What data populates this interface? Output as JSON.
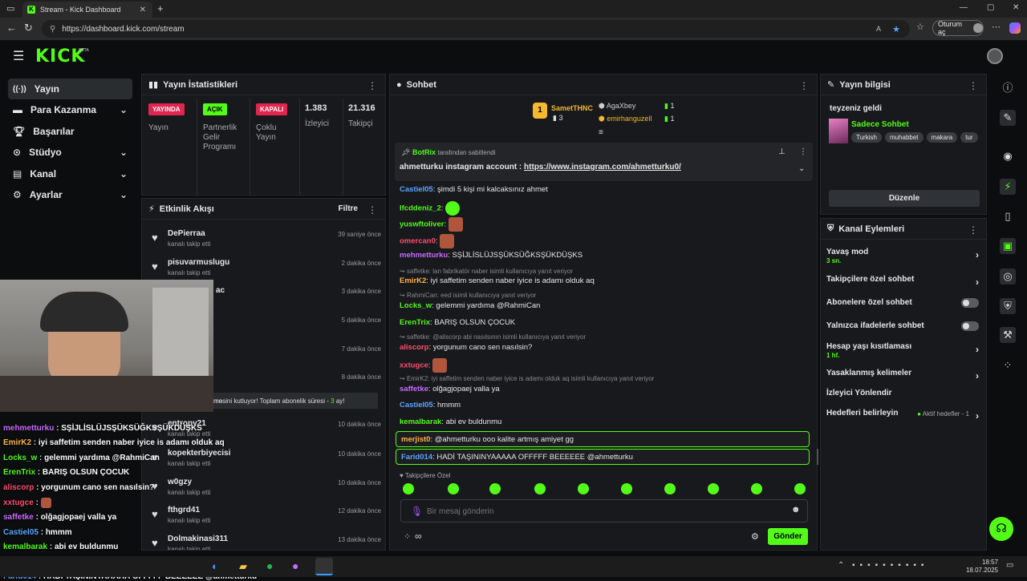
{
  "browser": {
    "tab_title": "Stream - Kick Dashboard",
    "url": "https://dashboard.kick.com/stream",
    "profile_label": "Oturum aç"
  },
  "brand": {
    "logo": "KICK",
    "beta": "BETA",
    "accent": "#53fc18"
  },
  "sidebar": {
    "items": [
      {
        "label": "Yayın",
        "icon": "broadcast-icon"
      },
      {
        "label": "Para Kazanma",
        "icon": "money-icon"
      },
      {
        "label": "Başarılar",
        "icon": "trophy-icon"
      },
      {
        "label": "Stüdyo",
        "icon": "studio-icon"
      },
      {
        "label": "Kanal",
        "icon": "channel-icon"
      },
      {
        "label": "Ayarlar",
        "icon": "gear-icon"
      }
    ]
  },
  "stats": {
    "title": "Yayın İstatistikleri",
    "boxes": [
      {
        "tag": "YAYINDA",
        "label": "Yayın"
      },
      {
        "tag": "AÇIK",
        "label": "Partnerlik Gelir Programı"
      },
      {
        "tag": "KAPALI",
        "label": "Çoklu Yayın"
      },
      {
        "value": "1.383",
        "label": "İzleyici"
      },
      {
        "value": "21.316",
        "label": "Takipçi"
      }
    ]
  },
  "activity": {
    "title": "Etkinlik Akışı",
    "filter": "Filtre",
    "events": [
      {
        "name": "DePierraa",
        "sub": "kanalı takip etti",
        "time": "39 saniye önce"
      },
      {
        "name": "pisuvarmuslugu",
        "sub": "kanalı takip etti",
        "time": "2 dakika önce"
      },
      {
        "name": "",
        "sub": "",
        "time": "3 dakika önce",
        "partial": "ac"
      },
      {
        "name": "",
        "sub": "",
        "time": "5 dakika önce"
      },
      {
        "name": "",
        "sub": "",
        "time": "7 dakika önce"
      },
      {
        "name": "",
        "sub": "",
        "time": "8 dakika önce"
      },
      {
        "name": "entropy21",
        "sub": "kanalı takip etti",
        "time": "10 dakika önce"
      },
      {
        "name": "kopekterbiyecisi",
        "sub": "kanalı takip etti",
        "time": "10 dakika önce"
      },
      {
        "name": "w0gzy",
        "sub": "kanalı takip etti",
        "time": "10 dakika önce"
      },
      {
        "name": "fthgrd41",
        "sub": "kanalı takip etti",
        "time": "12 dakika önce"
      },
      {
        "name": "Dolmakinasi311",
        "sub": "kanalı takip etti",
        "time": "13 dakika önce"
      }
    ],
    "sub_notice": "mesini kutluyor! Toplam abonelik süresi -",
    "sub_months": "3",
    "sub_months_suffix": "ay!",
    "sub_notice2": "mo"
  },
  "chat": {
    "title": "Sohbet",
    "leaders": [
      {
        "name": "SametTHNC",
        "count": "3"
      },
      {
        "name": "AgaXbey",
        "count": "1"
      },
      {
        "name": "emirhanguzell",
        "count": "1"
      }
    ],
    "pinned_by": "BotRix",
    "pinned_suffix": "tarafından sabitlendi",
    "pinned_text": "ahmetturku instagram account :",
    "pinned_link": "https://www.instagram.com/ahmetturku0/",
    "messages": [
      {
        "user": "Castiel05",
        "color": "#5aa6ff",
        "text": "şimdi 5 kişi mi kalcaksınız ahmet"
      },
      {
        "user": "lfcddeniz_2",
        "color": "#53fc18",
        "text": ""
      },
      {
        "user": "yuswftoliver",
        "color": "#53fc18",
        "text": ""
      },
      {
        "user": "omercan0",
        "color": "#ff4d6d",
        "text": ""
      },
      {
        "user": "mehmetturku",
        "color": "#c86bff",
        "text": "SŞİJLİSLÜJSŞÜKSÜĞKSŞÜKDÜŞKS"
      },
      {
        "reply": "saffetke: lan fabrikatör naber isimli kullanıcıya yanıt veriyor"
      },
      {
        "user": "EmirK2",
        "color": "#ffb347",
        "text": "iyi saffetim senden naber iyice is adamı olduk aq"
      },
      {
        "reply": "RahmiCan: eed isimli kullanıcıya yanıt veriyor"
      },
      {
        "user": "Locks_w",
        "color": "#53fc18",
        "text": "gelemmi yardıma @RahmiCan"
      },
      {
        "user": "ErenTrix",
        "color": "#53fc18",
        "text": "BARIŞ OLSUN ÇOCUK"
      },
      {
        "reply": "saffetke: @aliscorp abi nasılsının isimli kullanıcıya yanıt veriyor"
      },
      {
        "user": "aliscorp",
        "color": "#ff4d6d",
        "text": "yorgunum cano sen nasılsin?"
      },
      {
        "user": "xxtugce",
        "color": "#ff4d6d",
        "text": ""
      },
      {
        "reply": "EmirK2: iyi saffetim senden naber iyice is adamı olduk aq isimli kullanıcıya yanıt veriyor"
      },
      {
        "user": "saffetke",
        "color": "#c86bff",
        "text": "olğagjopaej valla ya"
      },
      {
        "user": "Castiel05",
        "color": "#5aa6ff",
        "text": "hmmm"
      },
      {
        "user": "kemalbarak",
        "color": "#53fc18",
        "text": "abi ev buldunmu"
      }
    ],
    "highlighted": [
      {
        "user": "merjist0",
        "color": "#ffb347",
        "text": "@ahmetturku ooo kalite artmış amiyet gg"
      },
      {
        "user": "Farid014",
        "color": "#5aa6ff",
        "text": "HADİ TAŞININYAAAAA OFFFFF BEEEEEE @ahmetturku"
      }
    ],
    "followers_only": "Takipçilere Özel",
    "input_placeholder": "Bir mesaj gönderin",
    "send": "Gönder"
  },
  "stream_info": {
    "title": "Yayın bilgisi",
    "stream_title": "teyzeniz geldi",
    "category": "Sadece Sohbet",
    "tags": [
      "Turkish",
      "muhabbet",
      "makara",
      "tur"
    ],
    "edit": "Düzenle"
  },
  "channel_actions": {
    "title": "Kanal Eylemleri",
    "rows": [
      {
        "label": "Yavaş mod",
        "sub": "3 sn.",
        "type": "chevron"
      },
      {
        "label": "Takipçilere özel sohbet",
        "type": "chevron"
      },
      {
        "label": "Abonelere özel sohbet",
        "type": "toggle"
      },
      {
        "label": "Yalnızca ifadelerle sohbet",
        "type": "toggle"
      },
      {
        "label": "Hesap yaşı kısıtlaması",
        "sub": "1 hf.",
        "type": "chevron"
      },
      {
        "label": "Yasaklanmış kelimeler",
        "type": "chevron"
      },
      {
        "label": "İzleyici Yönlendir",
        "type": "none"
      },
      {
        "label": "Hedefleri belirleyin",
        "badge": "Aktif hedefler - 1",
        "type": "chevron"
      }
    ]
  },
  "overlay_chat": [
    {
      "user": "mehmetturku",
      "color": "#c86bff",
      "text": "SŞİJLİSLÜJSŞÜKSÜĞKSŞÜKDÜŞKS"
    },
    {
      "user": "EmirK2",
      "color": "#ffb347",
      "text": "iyi saffetim senden naber iyice is adamı olduk aq"
    },
    {
      "user": "Locks_w",
      "color": "#53fc18",
      "text": "gelemmi yardıma @RahmiCan"
    },
    {
      "user": "ErenTrix",
      "color": "#53fc18",
      "text": "BARIŞ OLSUN ÇOCUK"
    },
    {
      "user": "aliscorp",
      "color": "#ff4d6d",
      "text": "yorgunum cano sen nasılsin?"
    },
    {
      "user": "xxtugce",
      "color": "#ff4d6d",
      "text": ""
    },
    {
      "user": "saffetke",
      "color": "#c86bff",
      "text": "olğagjopaej valla ya"
    },
    {
      "user": "Castiel05",
      "color": "#5aa6ff",
      "text": "hmmm"
    },
    {
      "user": "kemalbarak",
      "color": "#53fc18",
      "text": "abi ev buldunmu"
    },
    {
      "user": "merjist0",
      "color": "#ffb347",
      "text": "@ahmetturku",
      "text2": "kalite artmış amiyet gg"
    },
    {
      "user": "Farid014",
      "color": "#5aa6ff",
      "text": "HADİ TAŞININYAAAAA OFFFFF BEEEEEE @ahmetturku"
    }
  ],
  "taskbar": {
    "time": "18:57",
    "date": "18.07.2025"
  }
}
